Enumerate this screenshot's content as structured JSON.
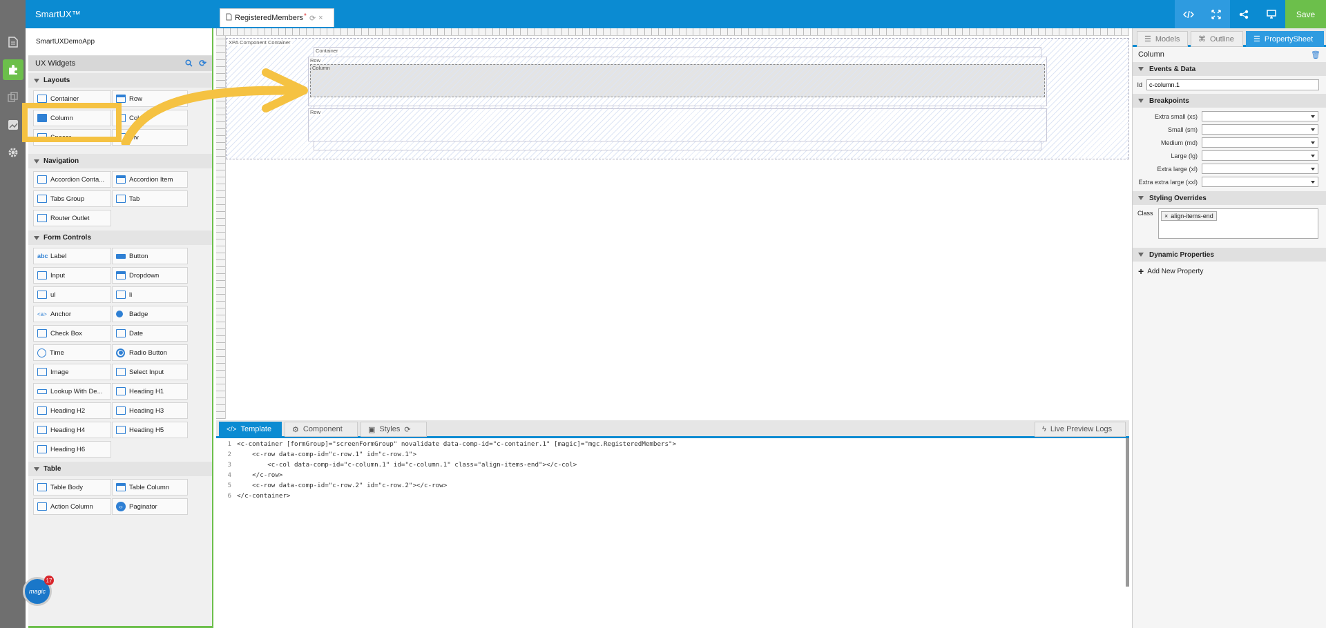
{
  "app": {
    "title": "SmartUX™",
    "save_label": "Save"
  },
  "document_tab": {
    "label": "RegisteredMembers",
    "dirty_marker": "*"
  },
  "widgets_panel": {
    "app_name": "SmartUXDemoApp",
    "header": "UX Widgets",
    "sections": [
      {
        "title": "Layouts",
        "items": [
          "Container",
          "Row",
          "Column",
          "Col",
          "Spacer",
          "Div"
        ]
      },
      {
        "title": "Navigation",
        "items": [
          "Accordion Conta...",
          "Accordion Item",
          "Tabs Group",
          "Tab",
          "Router Outlet"
        ]
      },
      {
        "title": "Form Controls",
        "items": [
          "Label",
          "Button",
          "Input",
          "Dropdown",
          "ul",
          "li",
          "Anchor",
          "Badge",
          "Check Box",
          "Date",
          "Time",
          "Radio Button",
          "Image",
          "Select Input",
          "Lookup With De...",
          "Heading H1",
          "Heading H2",
          "Heading H3",
          "Heading H4",
          "Heading H5",
          "Heading H6"
        ]
      },
      {
        "title": "Table",
        "items": [
          "Table Body",
          "Table Column",
          "Action Column",
          "Paginator"
        ]
      }
    ]
  },
  "canvas": {
    "labels": {
      "root": "XPA Component Container",
      "container": "Container",
      "row1": "Row",
      "column": "Column",
      "row2": "Row"
    }
  },
  "bottom_tabs": {
    "template": "Template",
    "component": "Component",
    "styles": "Styles",
    "logs": "Live Preview Logs"
  },
  "code_lines": [
    "<c-container [formGroup]=\"screenFormGroup\" novalidate data-comp-id=\"c-container.1\" [magic]=\"mgc.RegisteredMembers\">",
    "    <c-row data-comp-id=\"c-row.1\" id=\"c-row.1\">",
    "        <c-col data-comp-id=\"c-column.1\" id=\"c-column.1\" class=\"align-items-end\"></c-col>",
    "    </c-row>",
    "    <c-row data-comp-id=\"c-row.2\" id=\"c-row.2\"></c-row>",
    "</c-container>"
  ],
  "right_tabs": {
    "models": "Models",
    "outline": "Outline",
    "property": "PropertySheet"
  },
  "props": {
    "title": "Column",
    "events_section": "Events & Data",
    "id_label": "Id",
    "id_value": "c-column.1",
    "breakpoints_section": "Breakpoints",
    "breakpoints": [
      "Extra small (xs)",
      "Small (sm)",
      "Medium (md)",
      "Large (lg)",
      "Extra large (xl)",
      "Extra extra large (xxl)"
    ],
    "styling_section": "Styling Overrides",
    "class_label": "Class",
    "class_chip": "align-items-end",
    "dynamic_section": "Dynamic Properties",
    "add_property": "Add New Property"
  },
  "badge_count": "17",
  "logo_text": "magic",
  "colors": {
    "brand_blue": "#0b8bd2",
    "accent_green": "#6cbf4b",
    "highlight_yellow": "#f5c242"
  }
}
